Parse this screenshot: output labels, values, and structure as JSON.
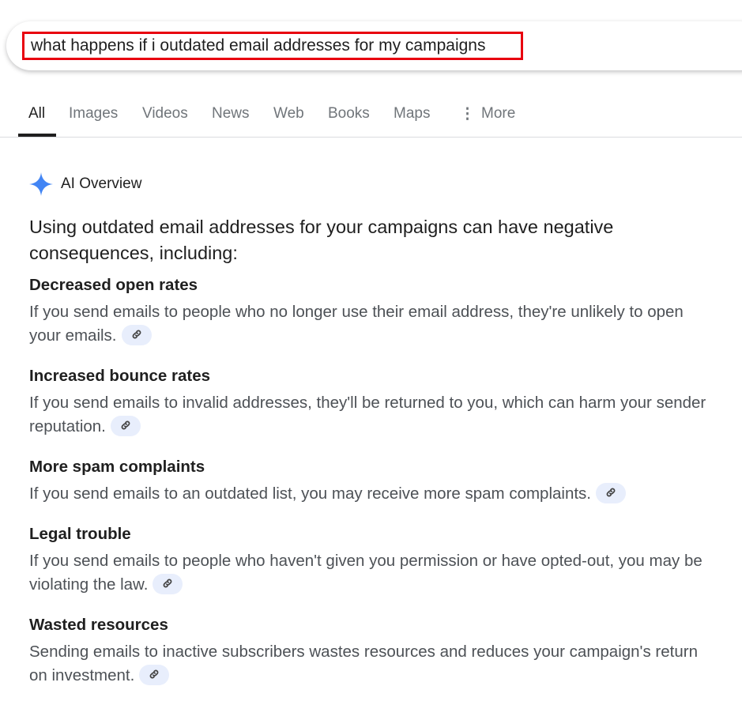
{
  "search": {
    "query": "what happens if i outdated email addresses for my campaigns"
  },
  "tabs": [
    {
      "label": "All",
      "active": true
    },
    {
      "label": "Images"
    },
    {
      "label": "Videos"
    },
    {
      "label": "News"
    },
    {
      "label": "Web"
    },
    {
      "label": "Books"
    },
    {
      "label": "Maps"
    },
    {
      "label": "More",
      "icon": "more-vert-icon"
    }
  ],
  "ai_overview": {
    "label": "AI Overview",
    "icon": "sparkle-icon",
    "accent": "#4285f4",
    "intro": "Using outdated email addresses for your campaigns can have negative consequences, including:",
    "sections": [
      {
        "title": "Decreased open rates",
        "body": "If you send emails to people who no longer use their email address, they're unlikely to open your emails."
      },
      {
        "title": "Increased bounce rates",
        "body": "If you send emails to invalid addresses, they'll be returned to you, which can harm your sender reputation."
      },
      {
        "title": "More spam complaints",
        "body": "If you send emails to an outdated list, you may receive more spam complaints."
      },
      {
        "title": "Legal trouble",
        "body": "If you send emails to people who haven't given you permission or have opted-out, you may be violating the law."
      },
      {
        "title": "Wasted resources",
        "body": "Sending emails to inactive subscribers wastes resources and reduces your campaign's return on investment."
      }
    ]
  }
}
